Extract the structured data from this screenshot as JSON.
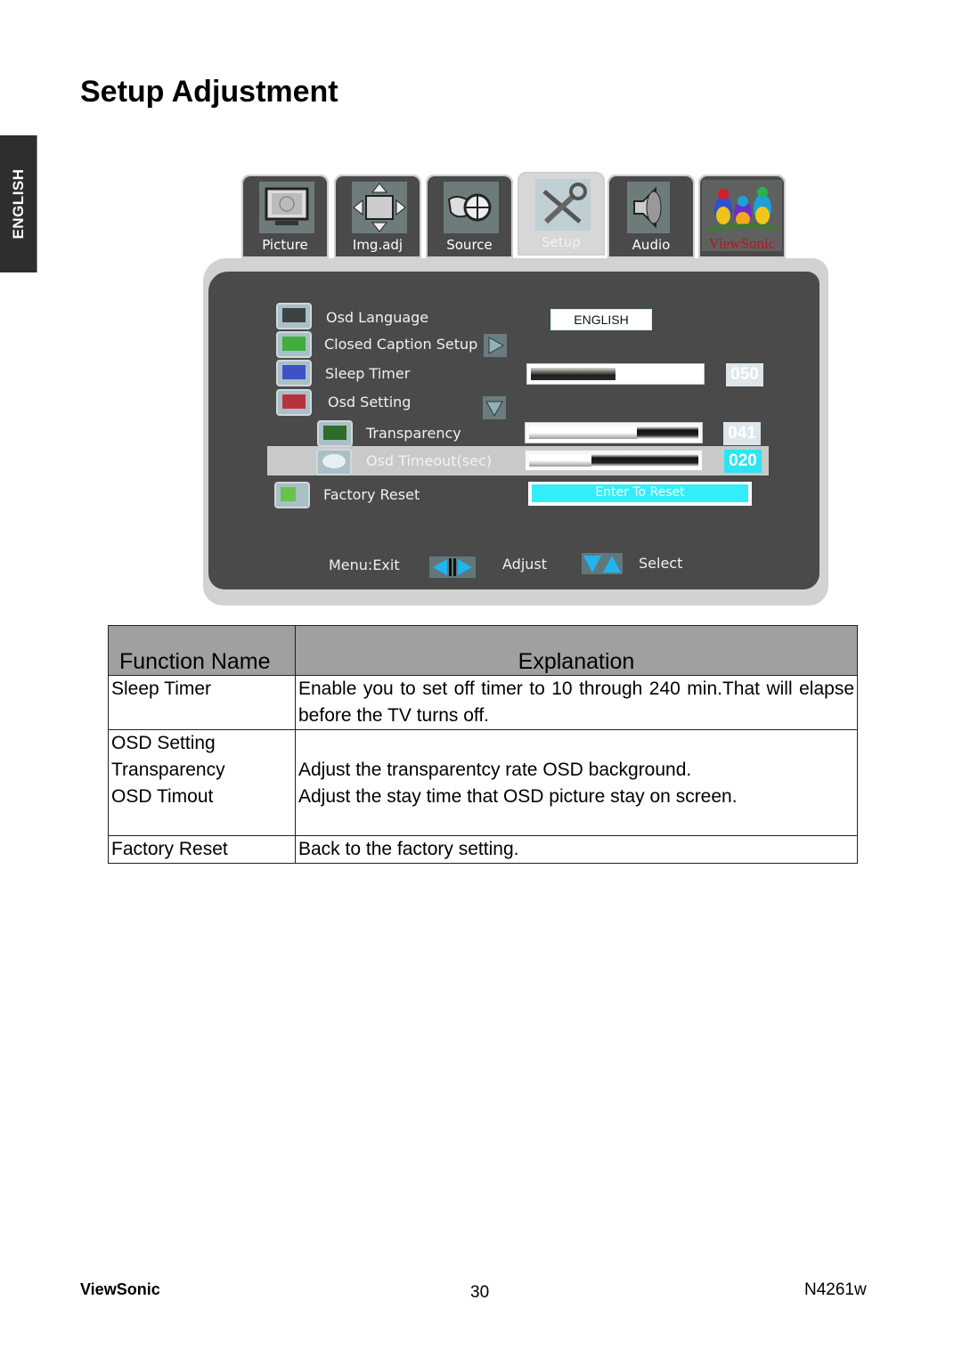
{
  "page": {
    "title": "Setup Adjustment",
    "language_tab": "ENGLISH"
  },
  "osd": {
    "tabs": [
      {
        "label": "Picture",
        "icon": "tv-icon",
        "active": false
      },
      {
        "label": "Img.adj",
        "icon": "move-arrows-icon",
        "active": false
      },
      {
        "label": "Source",
        "icon": "cable-plug-icon",
        "active": false
      },
      {
        "label": "Setup",
        "icon": "tools-icon",
        "active": true
      },
      {
        "label": "Audio",
        "icon": "speaker-icon",
        "active": false
      },
      {
        "label": "ViewSonic",
        "icon": "viewsonic-birds-logo",
        "active": false
      }
    ],
    "items": {
      "osd_language": {
        "label": "Osd Language",
        "value": "ENGLISH"
      },
      "closed_caption": {
        "label": "Closed Caption Setup"
      },
      "sleep_timer": {
        "label": "Sleep Timer",
        "value": "050",
        "level": 0.5
      },
      "osd_setting": {
        "label": "Osd Setting"
      },
      "transparency": {
        "label": "Transparency",
        "value": "041",
        "level": 0.41
      },
      "osd_timeout": {
        "label": "Osd Timeout(sec)",
        "value": "020",
        "level": 0.2,
        "selected": true
      },
      "factory_reset": {
        "label": "Factory Reset",
        "action": "Enter To Reset"
      }
    },
    "footer": {
      "exit": "Menu:Exit",
      "adjust": "Adjust",
      "select": "Select"
    },
    "colors": {
      "panel": "#4a4a4a",
      "frame": "#d2d2d2",
      "highlight": "#2ce4f3",
      "brand_red": "#c1121c"
    }
  },
  "table": {
    "headers": [
      "Function Name",
      "Explanation"
    ],
    "rows": [
      {
        "names": [
          "Sleep Timer"
        ],
        "explanations": [
          "Enable you to set off timer to 10 through 240 min.That will elapse before the TV turns off."
        ]
      },
      {
        "names": [
          "OSD Setting",
          "Transparency",
          "OSD Timout"
        ],
        "explanations": [
          "",
          "Adjust the transparentcy rate OSD background.",
          "Adjust the stay time that OSD picture stay on screen."
        ]
      },
      {
        "names": [
          "Factory Reset"
        ],
        "explanations": [
          "Back to the factory setting."
        ]
      }
    ]
  },
  "footer": {
    "brand": "ViewSonic",
    "page_number": "30",
    "model": "N4261w"
  }
}
